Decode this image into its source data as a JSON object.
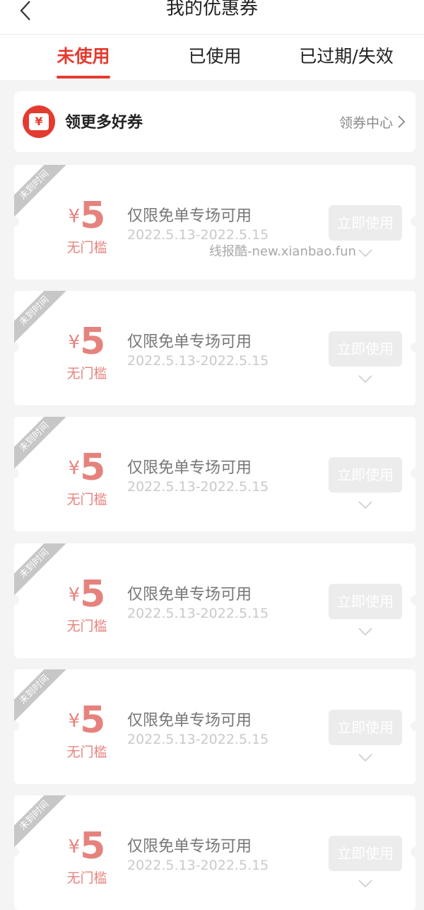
{
  "header": {
    "title": "我的优惠券"
  },
  "tabs": [
    {
      "label": "未使用",
      "active": true
    },
    {
      "label": "已使用",
      "active": false
    },
    {
      "label": "已过期/失效",
      "active": false
    }
  ],
  "promo": {
    "title": "领更多好券",
    "link": "领券中心",
    "icon_glyph": "¥"
  },
  "coupon": {
    "ribbon": "未到时间",
    "currency": "¥",
    "amount": "5",
    "threshold": "无门槛",
    "title": "仅限免单专场可用",
    "date": "2022.5.13-2022.5.15",
    "button": "立即使用"
  },
  "coupons_count": 6,
  "watermark": "线报酷-new.xianbao.fun",
  "colors": {
    "accent": "#e43b30",
    "amount": "#e6827d",
    "ribbon": "#c7c7c7"
  }
}
